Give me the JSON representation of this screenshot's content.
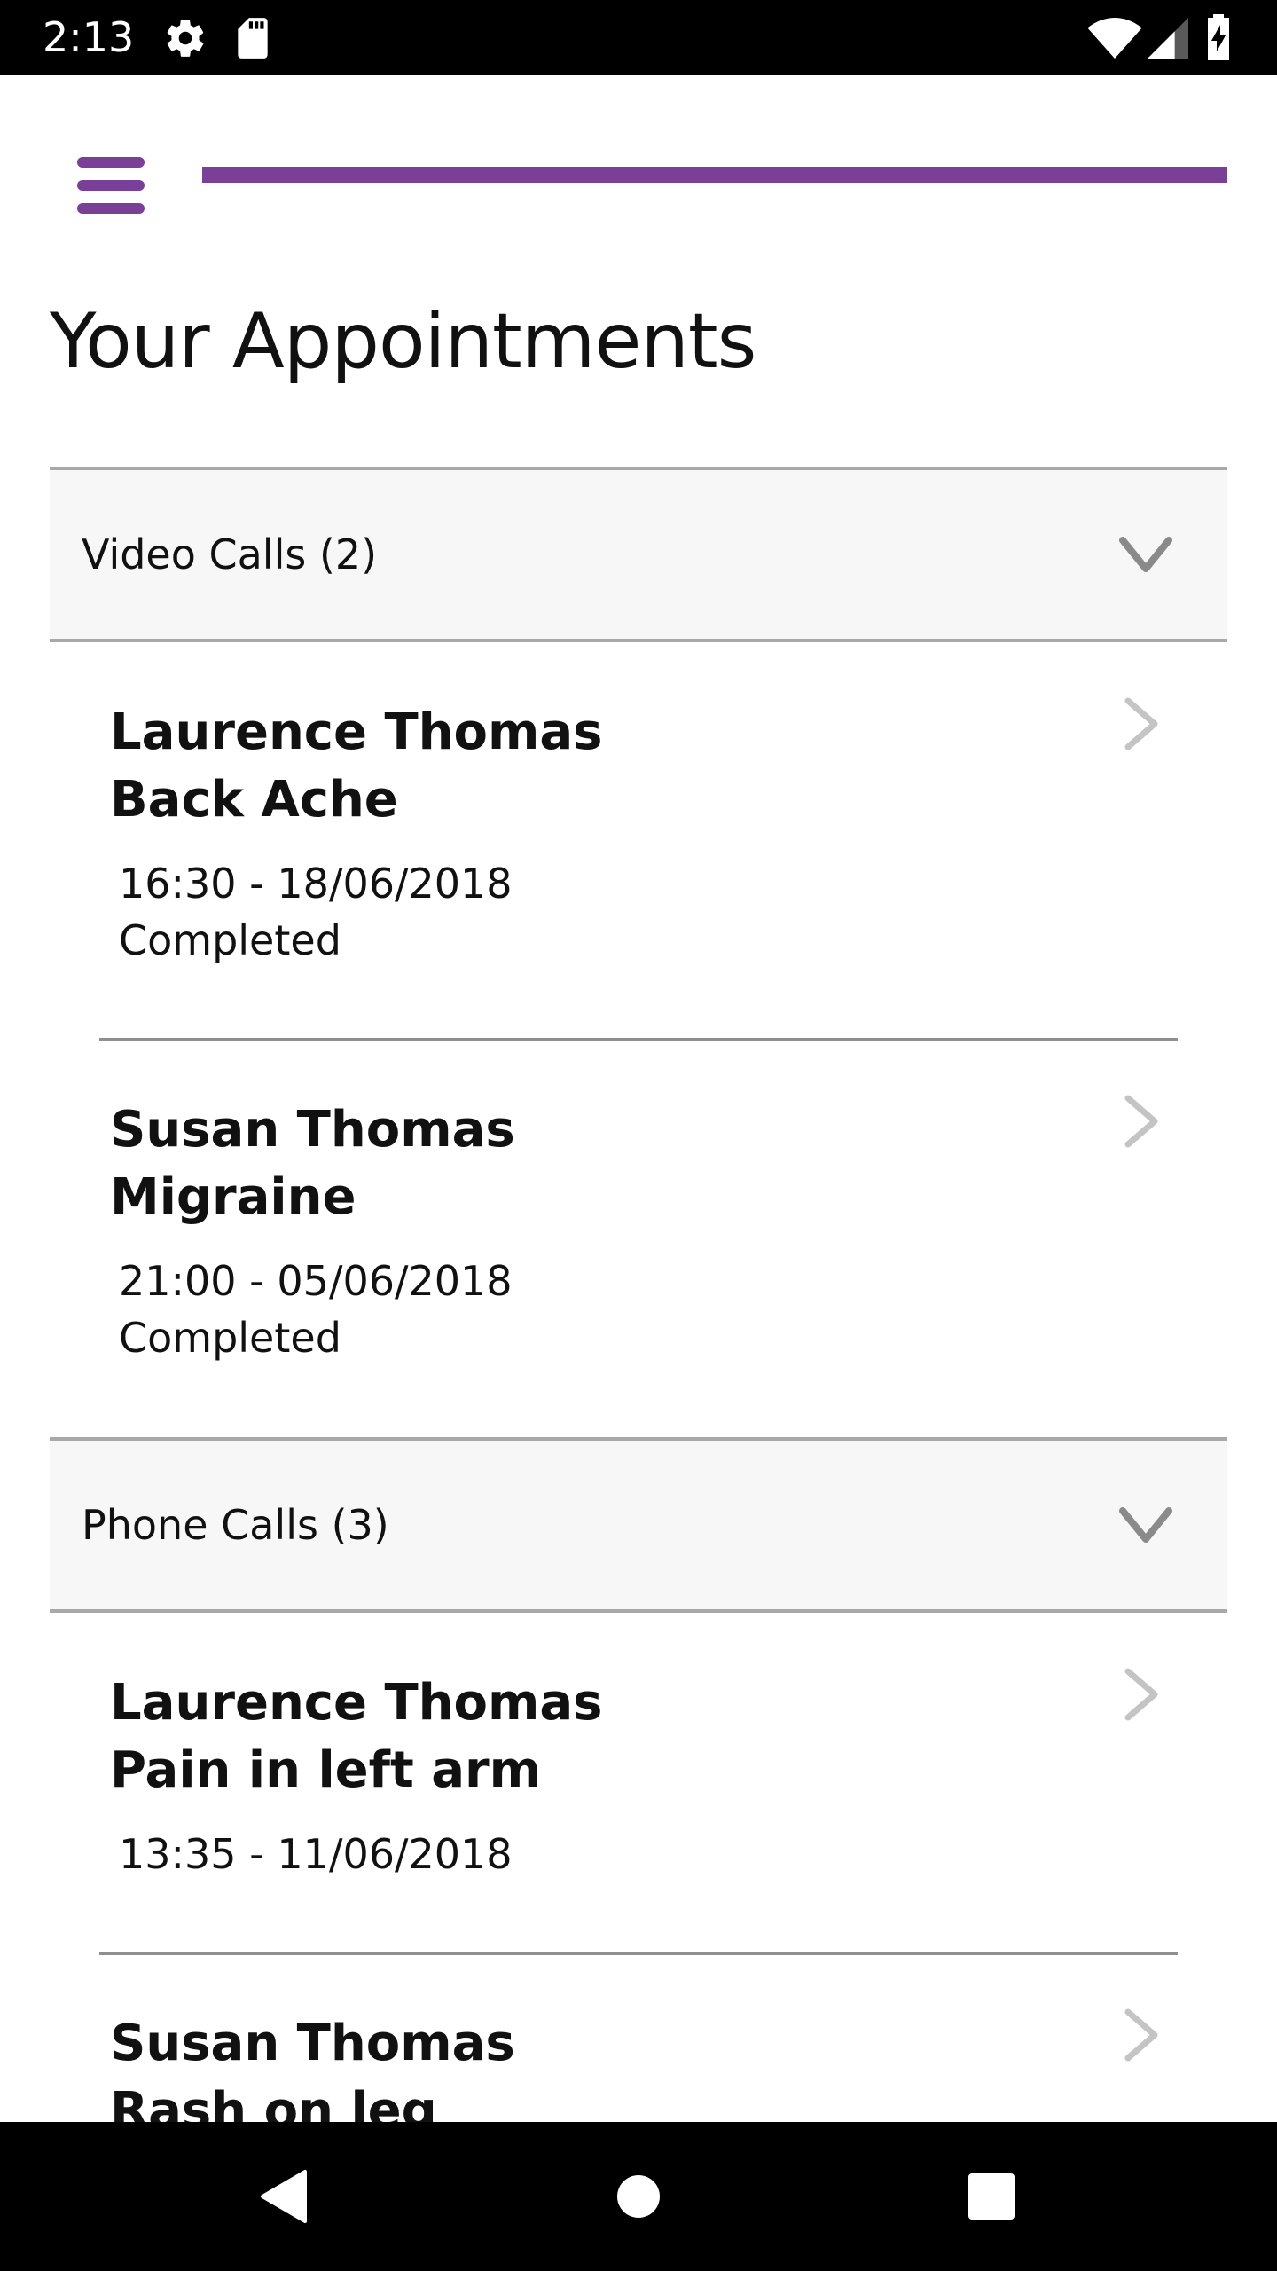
{
  "status_bar": {
    "time": "2:13",
    "icons": [
      "gear-icon",
      "sd-card-icon",
      "wifi-icon",
      "signal-icon",
      "battery-charging-icon"
    ]
  },
  "header": {
    "menu_icon": "hamburger-menu-icon",
    "accent_color": "#7a3f97"
  },
  "page": {
    "title": "Your Appointments"
  },
  "sections": [
    {
      "title": "Video Calls (2)",
      "items": [
        {
          "patient": "Laurence Thomas",
          "reason": "Back Ache",
          "datetime": "16:30 - 18/06/2018",
          "status": "Completed"
        },
        {
          "patient": "Susan Thomas",
          "reason": "Migraine",
          "datetime": "21:00 - 05/06/2018",
          "status": "Completed"
        }
      ]
    },
    {
      "title": "Phone Calls (3)",
      "items": [
        {
          "patient": "Laurence Thomas",
          "reason": "Pain in left arm",
          "datetime": "13:35 - 11/06/2018",
          "status": ""
        },
        {
          "patient": "Susan Thomas",
          "reason": "Rash on leg",
          "datetime": "",
          "status": ""
        }
      ]
    }
  ],
  "nav_bar": {
    "icons": [
      "back-icon",
      "home-icon",
      "recents-icon"
    ]
  }
}
